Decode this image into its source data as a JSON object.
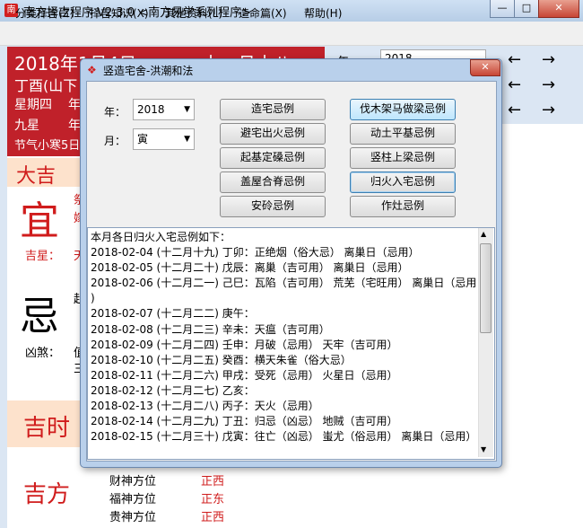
{
  "window": {
    "title": "南方择吉程序 V2.3.0  <南方易学系列程序>",
    "min": "—",
    "max": "□",
    "close": "✕"
  },
  "menu": [
    "分类择吉(Z)",
    "择吉知识(X)",
    "其他资料(L)",
    "造命篇(X)",
    "帮助(H)"
  ],
  "left": {
    "date": "2018年1月4日",
    "date_tail": "十一月十八",
    "line2": "丁酉(山下",
    "line3": "星期四",
    "line3b": "年",
    "line4": "九星",
    "line4b": "年",
    "line5": "节气小寒5日",
    "daji": "大吉",
    "yi": "宜",
    "yi_frag1": "祭",
    "yi_frag2": "嫁",
    "jixing_label": "吉星：",
    "jixing_frag": "天",
    "ji": "忌",
    "ji_frag": "起",
    "xiongsha_label": "凶煞：",
    "xiongsha_frag1": "值",
    "xiongsha_frag2": "三",
    "jishi": "吉时",
    "jifang": "吉方",
    "directions": [
      {
        "name": "财神方位",
        "value": "正西"
      },
      {
        "name": "福神方位",
        "value": "正东"
      },
      {
        "name": "贵神方位",
        "value": "正西"
      }
    ]
  },
  "right": {
    "year_label": "年:",
    "year_value": "2018",
    "arrow_left": "←",
    "arrow_right": "→"
  },
  "dialog": {
    "title": "竖造宅舍-洪潮和法",
    "close": "✕",
    "year_label": "年：",
    "year_value": "2018",
    "month_label": "月：",
    "month_value": "寅",
    "buttons_left": [
      "造宅忌例",
      "避宅出火忌例",
      "起基定磉忌例",
      "盖屋合脊忌例",
      "安砱忌例"
    ],
    "buttons_right": [
      "伐木架马做梁忌例",
      "动土平基忌例",
      "竖柱上梁忌例",
      "归火入宅忌例",
      "作灶忌例"
    ],
    "list_header": "本月各日归火入宅忌例如下：",
    "list": [
      "2018-02-04 (十二月十九) 丁卯：正绝烟（俗大忌） 离巢日（忌用）",
      "2018-02-05 (十二月二十) 戊辰：离巢（吉可用） 离巢日（忌用）",
      "2018-02-06 (十二月二一) 己巳：瓦陷（吉可用） 荒芜（宅旺用） 离巢日（忌用",
      ")",
      "2018-02-07 (十二月二二) 庚午：",
      "2018-02-08 (十二月二三) 辛未：天瘟（吉可用）",
      "2018-02-09 (十二月二四) 壬申：月破（忌用） 天牢（吉可用）",
      "2018-02-10 (十二月二五) 癸酉：横天朱雀（俗大忌）",
      "2018-02-11 (十二月二六) 甲戌：受死（忌用） 火星日（忌用）",
      "2018-02-12 (十二月二七) 乙亥：",
      "2018-02-13 (十二月二八) 丙子：天火（忌用）",
      "2018-02-14 (十二月二九) 丁丑：归忌（凶忌） 地贼（吉可用）",
      "2018-02-15 (十二月三十) 戊寅：往亡（凶忌） 蚩尤（俗忌用） 离巢日（忌用）"
    ]
  }
}
